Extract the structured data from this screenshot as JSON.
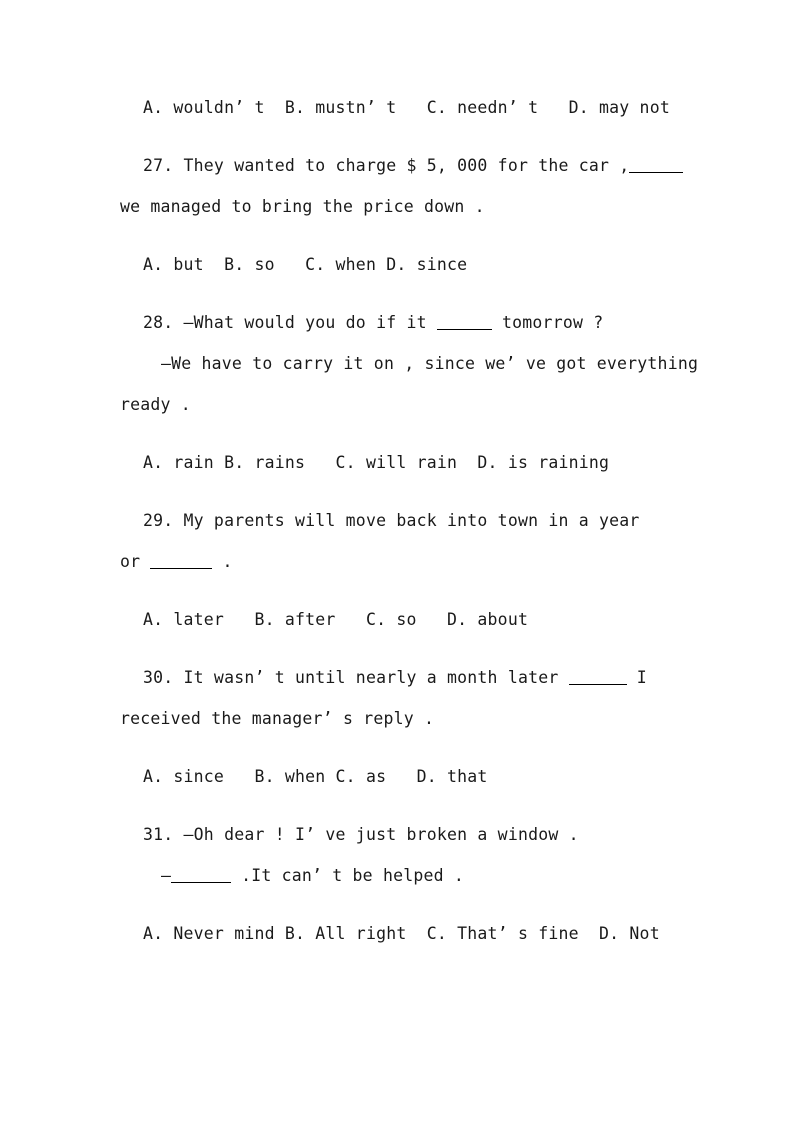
{
  "document": {
    "page_background": "#ffffff",
    "text_color": "#1a1a1a",
    "blank_rule_color": "#000000",
    "lines": {
      "l01_options_26": "A. wouldn’ t  B. mustn’ t   C. needn’ t   D. may not",
      "l02_q27_a": "27. They wanted to charge $ 5, 000 for the car ,",
      "l03_q27_b": "we managed to bring the price down .",
      "l04_options_27": "A. but  B. so   C. when D. since",
      "l05_q28_a_pre": "28. —What would you do if it ",
      "l05_q28_a_post": " tomorrow ?",
      "l06_q28_b": "—We have to carry it on , since we’ ve got everything",
      "l07_q28_c": "ready .",
      "l08_options_28": "A. rain B. rains   C. will rain  D. is raining",
      "l09_q29_a": "29. My parents will move back into town in a year",
      "l10_q29_b_pre": "or ",
      "l10_q29_b_post": " .",
      "l11_options_29": "A. later   B. after   C. so   D. about",
      "l12_q30_a_pre": "30. It wasn’ t until nearly a month later ",
      "l12_q30_a_post": " I",
      "l13_q30_b": "received the manager’ s reply .",
      "l14_options_30": "A. since   B. when C. as   D. that",
      "l15_q31_a": "31. —Oh dear ! I’ ve just broken a window .",
      "l16_q31_b_pre": "—",
      "l16_q31_b_post": " .It can’ t be helped .",
      "l17_options_31": "A. Never mind B. All right  C. That’ s fine  D. Not"
    }
  }
}
